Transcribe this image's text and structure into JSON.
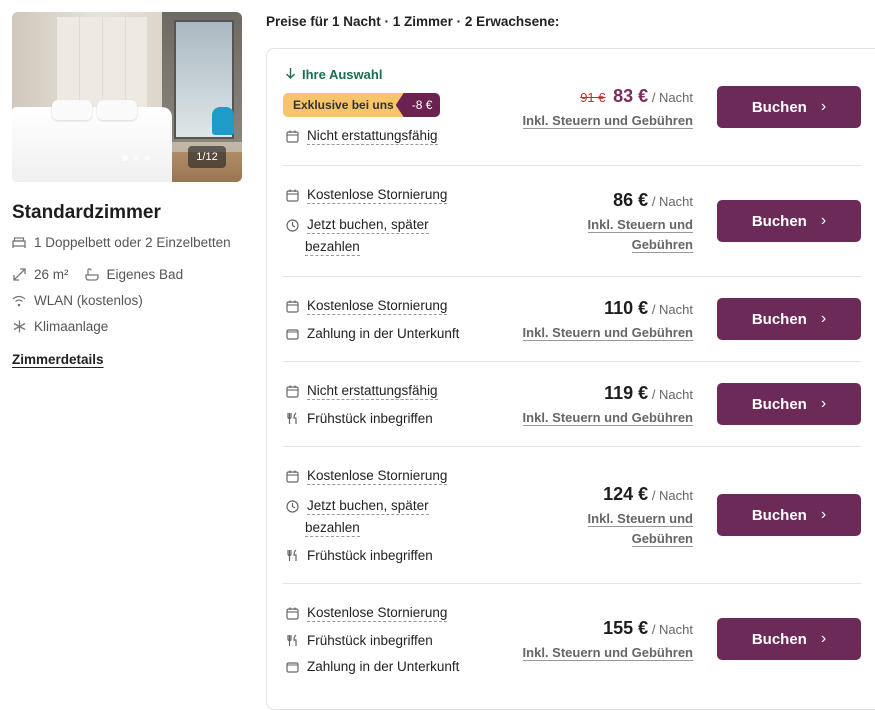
{
  "header": {
    "text": "Preise für 1 Nacht · 1 Zimmer · 2 Erwachsene:"
  },
  "photo": {
    "counter": "1/12"
  },
  "room": {
    "title": "Standardzimmer",
    "bed": "1 Doppelbett oder 2 Einzelbetten",
    "size": "26 m²",
    "bath": "Eigenes Bad",
    "wifi": "WLAN (kostenlos)",
    "ac": "Klimaanlage",
    "details_link": "Zimmerdetails"
  },
  "selection": {
    "label": "Ihre Auswahl",
    "badge_text": "Exklusive bei uns",
    "badge_discount": "-8 €"
  },
  "common": {
    "per_night": "/ Nacht",
    "incl_taxes": "Inkl. Steuern und Gebühren",
    "incl_line1": "Inkl. Steuern und",
    "incl_line2": "Gebühren",
    "book": "Buchen"
  },
  "rates": [
    {
      "tags": [
        "Nicht erstattungsfähig"
      ],
      "old_price": "91 €",
      "price": "83 €"
    },
    {
      "tags": [
        "Kostenlose Stornierung",
        "Jetzt buchen, später",
        "bezahlen"
      ],
      "price": "86 €"
    },
    {
      "tags": [
        "Kostenlose Stornierung",
        "Zahlung in der Unterkunft"
      ],
      "price": "110 €"
    },
    {
      "tags": [
        "Nicht erstattungsfähig",
        "Frühstück inbegriffen"
      ],
      "price": "119 €"
    },
    {
      "tags": [
        "Kostenlose Stornierung",
        "Jetzt buchen, später",
        "bezahlen",
        "Frühstück inbegriffen"
      ],
      "price": "124 €"
    },
    {
      "tags": [
        "Kostenlose Stornierung",
        "Frühstück inbegriffen",
        "Zahlung in der Unterkunft"
      ],
      "price": "155 €"
    }
  ],
  "colors": {
    "accent": "#6b2a58",
    "sale": "#c0312b",
    "choice": "#1a6e54",
    "badge": "#f6c46b"
  }
}
